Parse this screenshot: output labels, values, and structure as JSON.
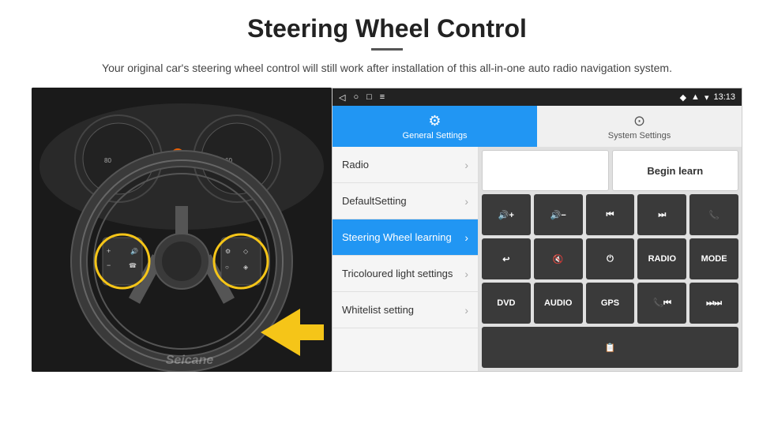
{
  "page": {
    "title": "Steering Wheel Control",
    "subtitle": "Your original car's steering wheel control will still work after installation of this all-in-one auto radio navigation system."
  },
  "status_bar": {
    "nav_back": "◁",
    "nav_home": "○",
    "nav_square": "□",
    "nav_menu": "≡",
    "time": "13:13",
    "signal": "▲▲",
    "wifi": "▾"
  },
  "tabs": [
    {
      "id": "general",
      "label": "General Settings",
      "icon": "⚙",
      "active": true
    },
    {
      "id": "system",
      "label": "System Settings",
      "icon": "⊙",
      "active": false
    }
  ],
  "menu_items": [
    {
      "id": "radio",
      "label": "Radio",
      "active": false
    },
    {
      "id": "default-setting",
      "label": "DefaultSetting",
      "active": false
    },
    {
      "id": "steering-wheel-learning",
      "label": "Steering Wheel learning",
      "active": true
    },
    {
      "id": "tricoloured-light",
      "label": "Tricoloured light settings",
      "active": false
    },
    {
      "id": "whitelist",
      "label": "Whitelist setting",
      "active": false
    }
  ],
  "buttons": {
    "begin_learn": "Begin learn",
    "row1": [
      "🔊+",
      "🔊−",
      "⏮",
      "⏭",
      "📞"
    ],
    "row2": [
      "↩",
      "🔇",
      "⏻",
      "RADIO",
      "MODE"
    ],
    "row3": [
      "DVD",
      "AUDIO",
      "GPS",
      "📞⏮",
      "⏭⏭"
    ],
    "row4": [
      "📋"
    ]
  },
  "watermark": "Seicane"
}
